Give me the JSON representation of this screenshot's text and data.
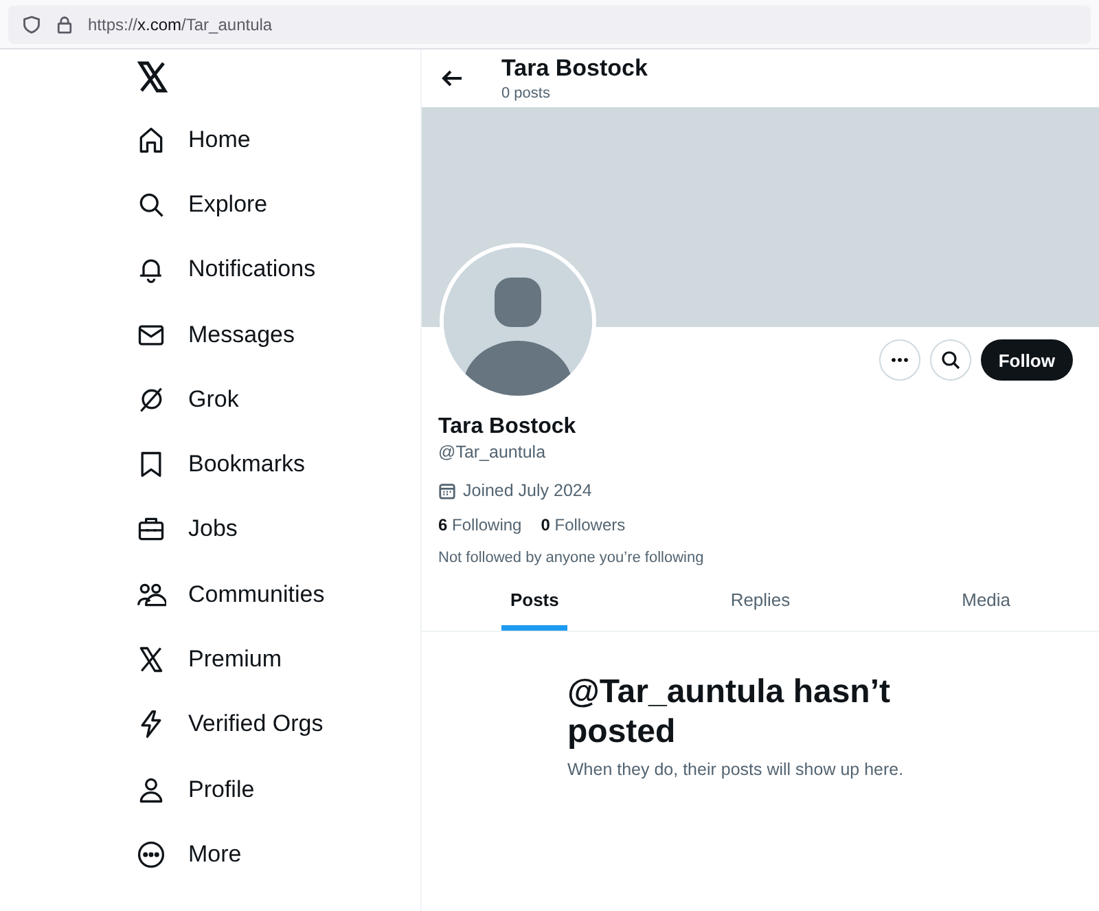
{
  "browser": {
    "url_host": "https://x.com",
    "url_path": "/Tar_auntula"
  },
  "sidebar": {
    "items": [
      {
        "label": "Home"
      },
      {
        "label": "Explore"
      },
      {
        "label": "Notifications"
      },
      {
        "label": "Messages"
      },
      {
        "label": "Grok"
      },
      {
        "label": "Bookmarks"
      },
      {
        "label": "Jobs"
      },
      {
        "label": "Communities"
      },
      {
        "label": "Premium"
      },
      {
        "label": "Verified Orgs"
      },
      {
        "label": "Profile"
      },
      {
        "label": "More"
      }
    ]
  },
  "header": {
    "name": "Tara Bostock",
    "post_count": "0 posts"
  },
  "profile": {
    "name": "Tara Bostock",
    "handle": "@Tar_auntula",
    "joined": "Joined July 2024",
    "follow_button": "Follow",
    "stats": [
      {
        "count": "6",
        "label": "Following"
      },
      {
        "count": "0",
        "label": "Followers"
      }
    ],
    "followed_by": "Not followed by anyone you’re following"
  },
  "tabs": [
    {
      "label": "Posts",
      "selected": true
    },
    {
      "label": "Replies",
      "selected": false
    },
    {
      "label": "Media",
      "selected": false
    }
  ],
  "empty_state": {
    "title": "@Tar_auntula hasn’t posted",
    "subtitle": "When they do, their posts will show up here."
  }
}
